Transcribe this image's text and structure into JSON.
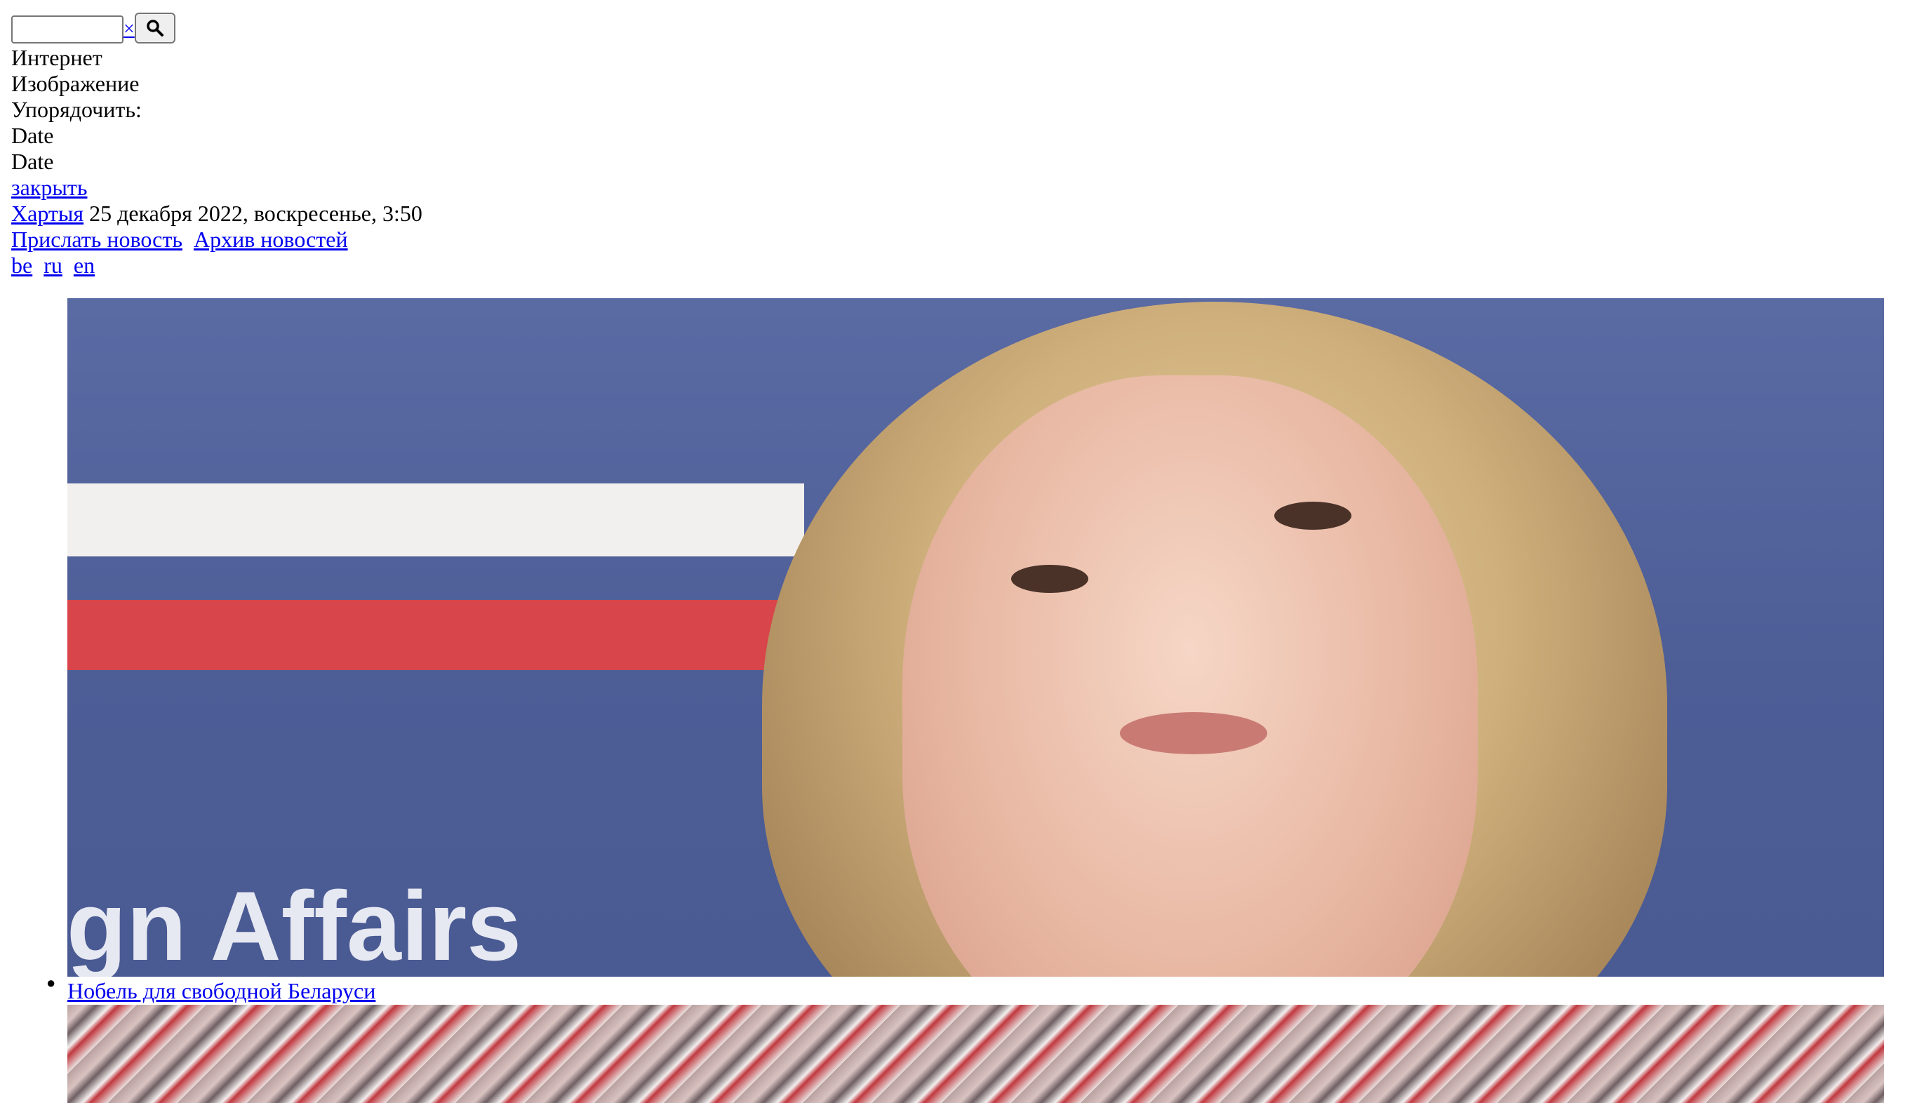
{
  "search": {
    "value": "",
    "clear_label": "×",
    "button_icon": "search-icon"
  },
  "menu": {
    "internet": "Интернет",
    "image": "Изображение",
    "sort_label": "Упорядочить:",
    "sort_option1": "Date",
    "sort_option2": "Date",
    "close": "закрыть"
  },
  "header": {
    "site_link": "Хартыя",
    "date_text": "25 декабря 2022, воскресенье, 3:50",
    "send_news": "Прислать новость",
    "news_archive": "Архив новостей"
  },
  "languages": [
    "be",
    "ru",
    "en"
  ],
  "news": [
    {
      "hero_text": "ign Affairs",
      "title": "Нобель для свободной Беларуси"
    }
  ],
  "colors": {
    "link": "#0000ee",
    "hero_background": "#5363a0"
  }
}
